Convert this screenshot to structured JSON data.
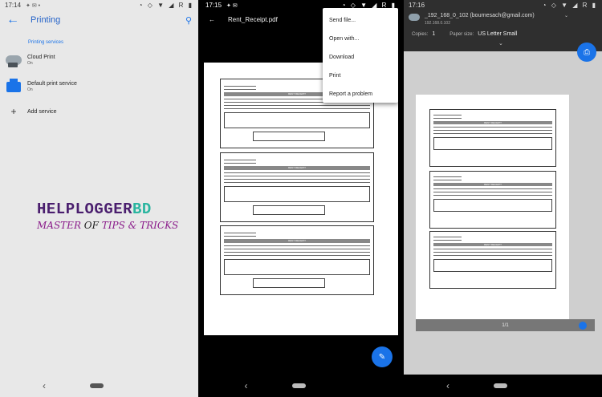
{
  "phone1": {
    "status": {
      "time": "17:14",
      "icons": "◔ ◇ ▼ ◢ R ▮"
    },
    "title": "Printing",
    "section": "Printing services",
    "services": [
      {
        "name": "Cloud Print",
        "state": "On"
      },
      {
        "name": "Default print service",
        "state": "On"
      }
    ],
    "add_service": "Add service",
    "watermark": {
      "line1a": "HELPLOGGER",
      "line1b": "BD",
      "line2a": "MASTER ",
      "line2b": "OF ",
      "line2c": "TIPS & TRICKS"
    }
  },
  "phone2": {
    "status": {
      "time": "17:15",
      "icons": "◔ ◇ ▼ ◢ R ▮"
    },
    "filename": "Rent_Receipt.pdf",
    "menu": [
      "Send file...",
      "Open with...",
      "Download",
      "Print",
      "Report a problem"
    ],
    "receipt_heading": "RENT RECEIPT"
  },
  "phone3": {
    "status": {
      "time": "17:16",
      "icons": "◔ ◇ ▼ ◢ R ▮"
    },
    "account": "_192_168_0_102 (bournesach@gmail.com)",
    "ip": "192.168.0.102",
    "copies_label": "Copies:",
    "copies_value": "1",
    "paper_label": "Paper size:",
    "paper_value": "US Letter Small",
    "page_counter": "1/1"
  },
  "colors": {
    "accent": "#1a73e8"
  }
}
